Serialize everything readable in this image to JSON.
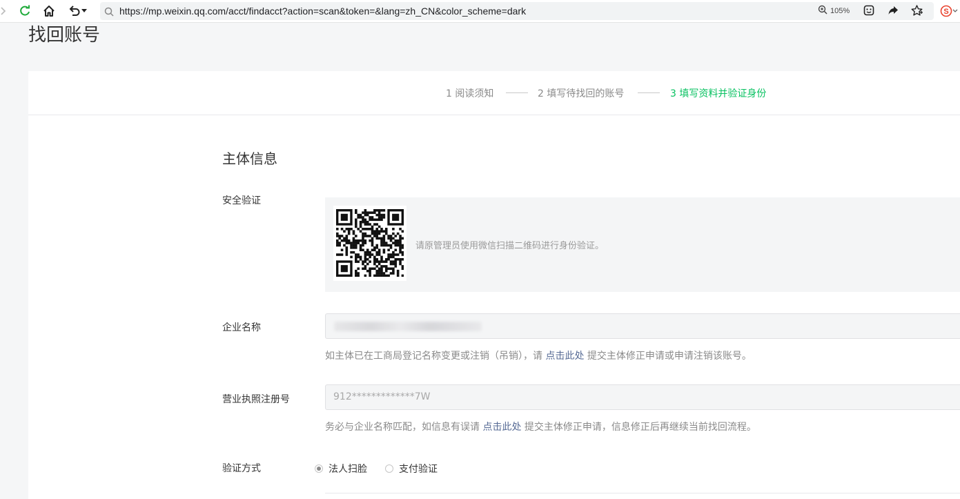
{
  "browser": {
    "url": "https://mp.weixin.qq.com/acct/findacct?action=scan&token=&lang=zh_CN&color_scheme=dark",
    "zoom": "105%"
  },
  "page": {
    "title": "找回账号"
  },
  "steps": [
    {
      "label": "1 阅读须知",
      "active": false
    },
    {
      "label": "2 填写待找回的账号",
      "active": false
    },
    {
      "label": "3 填写资料并验证身份",
      "active": true
    }
  ],
  "section": {
    "title": "主体信息"
  },
  "security": {
    "label": "安全验证",
    "hint": "请原管理员使用微信扫描二维码进行身份验证。"
  },
  "company": {
    "label": "企业名称",
    "tip_before": "如主体已在工商局登记名称变更或注销（吊销），请 ",
    "tip_link": "点击此处",
    "tip_after": " 提交主体修正申请或申请注销该账号。"
  },
  "license": {
    "label": "营业执照注册号",
    "value": "912*************7W",
    "tip_before": "务必与企业名称匹配，如信息有误请 ",
    "tip_link": "点击此处",
    "tip_after": " 提交主体修正申请，信息修正后再继续当前找回流程。"
  },
  "verify": {
    "label": "验证方式",
    "options": [
      {
        "label": "法人扫脸",
        "checked": true
      },
      {
        "label": "支付验证",
        "checked": false
      }
    ]
  },
  "colors": {
    "accent_green": "#07c160",
    "link_blue": "#576b95",
    "extension_red": "#e8412c"
  },
  "icons": [
    "forward-arrow-icon",
    "refresh-icon",
    "home-icon",
    "undo-icon",
    "chevron-down-icon",
    "search-icon",
    "zoom-icon",
    "face-icon",
    "share-icon",
    "star-icon",
    "extension-icon",
    "qr-code"
  ]
}
